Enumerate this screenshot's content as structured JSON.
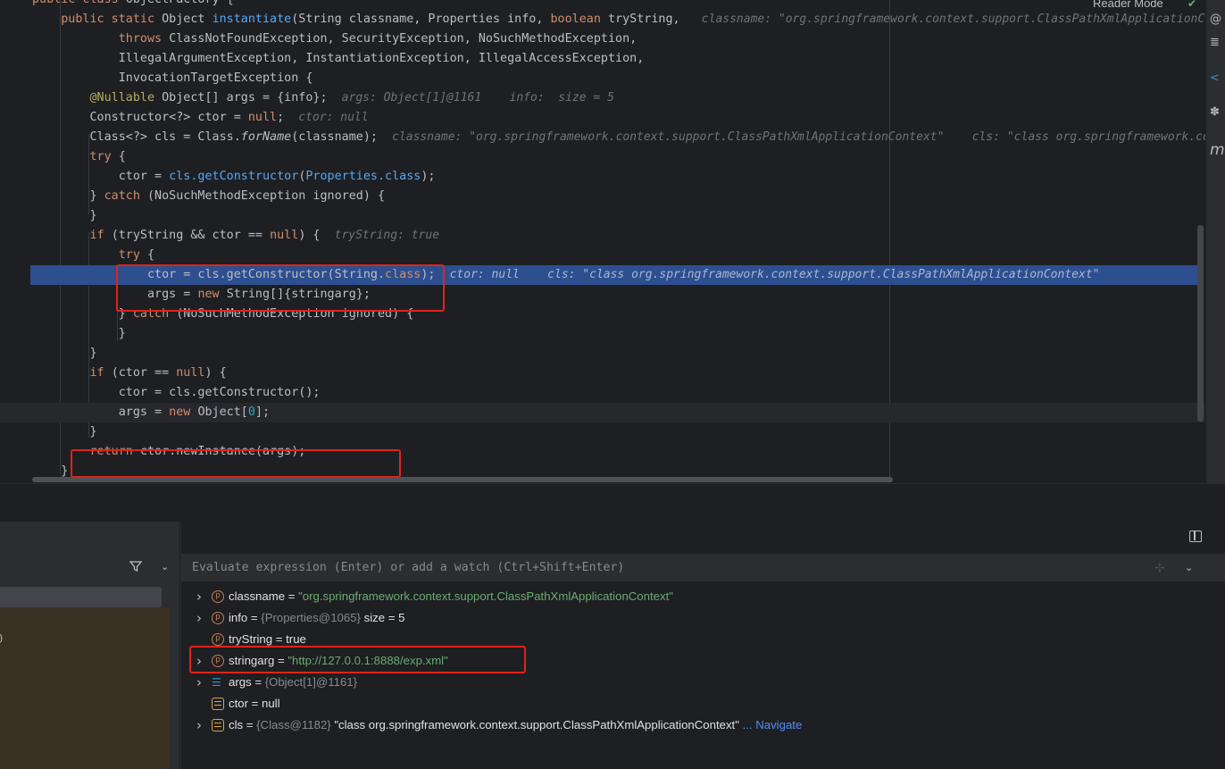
{
  "editor": {
    "reader_mode": "Reader Mode",
    "lines": [
      [
        {
          "t": "public class ",
          "c": "kw"
        },
        {
          "t": "ObjectFactory {",
          "c": ""
        }
      ],
      [
        {
          "t": "    "
        },
        {
          "t": "public static ",
          "c": "kw"
        },
        {
          "t": "Object "
        },
        {
          "t": "instantiate",
          "c": "fn"
        },
        {
          "t": "(String classname, Properties info, "
        },
        {
          "t": "boolean ",
          "c": "kw"
        },
        {
          "t": "tryString,   "
        },
        {
          "t": "classname: \"org.springframework.context.support.ClassPathXmlApplicationContext\"",
          "c": "hint"
        }
      ],
      [
        {
          "t": "            "
        },
        {
          "t": "throws ",
          "c": "kw"
        },
        {
          "t": "ClassNotFoundException, SecurityException, NoSuchMethodException,"
        }
      ],
      [
        {
          "t": "            IllegalArgumentException, InstantiationException, IllegalAccessException,"
        }
      ],
      [
        {
          "t": "            InvocationTargetException {"
        }
      ],
      [
        {
          "t": "        "
        },
        {
          "t": "@Nullable ",
          "c": "ann"
        },
        {
          "t": "Object[] args = {info};  "
        },
        {
          "t": "args: Object[1]@1161    info:  size = 5",
          "c": "hint"
        }
      ],
      [
        {
          "t": "        Constructor<?> ctor = "
        },
        {
          "t": "null",
          "c": "kw"
        },
        {
          "t": ";  "
        },
        {
          "t": "ctor: null",
          "c": "hint"
        }
      ],
      [
        {
          "t": "        Class<?> cls = Class."
        },
        {
          "t": "forName",
          "c": "ital"
        },
        {
          "t": "(classname);  "
        },
        {
          "t": "classname: \"org.springframework.context.support.ClassPathXmlApplicationContext\"    cls: \"class org.springframework.context.support.ClassPathXmlApplicationContext\"",
          "c": "hint"
        }
      ],
      [
        {
          "t": "        "
        },
        {
          "t": "try ",
          "c": "kw"
        },
        {
          "t": "{"
        }
      ],
      [
        {
          "t": "            ctor = "
        },
        {
          "t": "cls.getConstructor",
          "c": "fn"
        },
        {
          "t": "("
        },
        {
          "t": "Properties.class",
          "c": "fn"
        },
        {
          "t": ");"
        }
      ],
      [
        {
          "t": "        } "
        },
        {
          "t": "catch ",
          "c": "kw"
        },
        {
          "t": "(NoSuchMethodException ignored) {"
        }
      ],
      [
        {
          "t": "        }"
        }
      ],
      [
        {
          "t": "        "
        },
        {
          "t": "if ",
          "c": "kw"
        },
        {
          "t": "(tryString && ctor == "
        },
        {
          "t": "null",
          "c": "kw"
        },
        {
          "t": ") {  "
        },
        {
          "t": "tryString: true",
          "c": "hint"
        }
      ],
      [
        {
          "t": "            "
        },
        {
          "t": "try ",
          "c": "kw"
        },
        {
          "t": "{"
        }
      ],
      [
        {
          "t": "                ctor = cls.getConstructor(String."
        },
        {
          "t": "class",
          "c": "kw"
        },
        {
          "t": ");  "
        },
        {
          "t": "ctor: null    cls: \"class org.springframework.context.support.ClassPathXmlApplicationContext\"",
          "c": "hint"
        }
      ],
      [
        {
          "t": "                args = "
        },
        {
          "t": "new ",
          "c": "kw"
        },
        {
          "t": "String[]{stringarg};"
        }
      ],
      [
        {
          "t": "            } "
        },
        {
          "t": "catch ",
          "c": "kw"
        },
        {
          "t": "(NoSuchMethodException ignored) {"
        }
      ],
      [
        {
          "t": "            }"
        }
      ],
      [
        {
          "t": "        }"
        }
      ],
      [
        {
          "t": "        "
        },
        {
          "t": "if ",
          "c": "kw"
        },
        {
          "t": "(ctor == "
        },
        {
          "t": "null",
          "c": "kw"
        },
        {
          "t": ") {"
        }
      ],
      [
        {
          "t": "            ctor = cls.getConstructor();"
        }
      ],
      [
        {
          "t": "            args = "
        },
        {
          "t": "new ",
          "c": "kw"
        },
        {
          "t": "Object["
        },
        {
          "t": "0",
          "c": "num"
        },
        {
          "t": "];"
        }
      ],
      [
        {
          "t": "        }"
        }
      ],
      [
        {
          "t": "        "
        },
        {
          "t": "return ",
          "c": "kw"
        },
        {
          "t": "ctor.newInstance(args);"
        }
      ],
      [
        {
          "t": "    }"
        }
      ]
    ],
    "exec_line_index": 14,
    "caret_line_index": 21
  },
  "debugger": {
    "eval_placeholder": "Evaluate expression (Enter) or add a watch (Ctrl+Shift+Enter)",
    "variables": [
      {
        "icon": "p",
        "expand": true,
        "name": "classname",
        "eq": " = ",
        "val": "\"org.springframework.context.support.ClassPathXmlApplicationContext\"",
        "vclass": "vstr"
      },
      {
        "icon": "p",
        "expand": true,
        "name": "info",
        "eq": " = ",
        "ref": "{Properties@1065}",
        "val": "  size = 5",
        "vclass": "vplain"
      },
      {
        "icon": "p",
        "expand": false,
        "name": "tryString",
        "eq": " = ",
        "val": "true",
        "vclass": "vplain"
      },
      {
        "icon": "p",
        "expand": true,
        "name": "stringarg",
        "eq": " = ",
        "val": "\"http://127.0.0.1:8888/exp.xml\"",
        "vclass": "vstr"
      },
      {
        "icon": "list",
        "expand": true,
        "name": "args",
        "eq": " = ",
        "ref": "{Object[1]@1161}",
        "val": "",
        "vclass": "vplain"
      },
      {
        "icon": "db",
        "expand": false,
        "name": "ctor",
        "eq": " = ",
        "val": "null",
        "vclass": "vplain"
      },
      {
        "icon": "db",
        "expand": true,
        "name": "cls",
        "eq": " = ",
        "ref": "{Class@1182}",
        "val": " \"class org.springframework.context.support.ClassPathXmlApplicationContext\"",
        "vclass": "vplain",
        "link": " ... Navigate"
      }
    ]
  },
  "colors": {
    "highlight_box": "#e0231b",
    "exec_line": "#2d4f8f"
  }
}
